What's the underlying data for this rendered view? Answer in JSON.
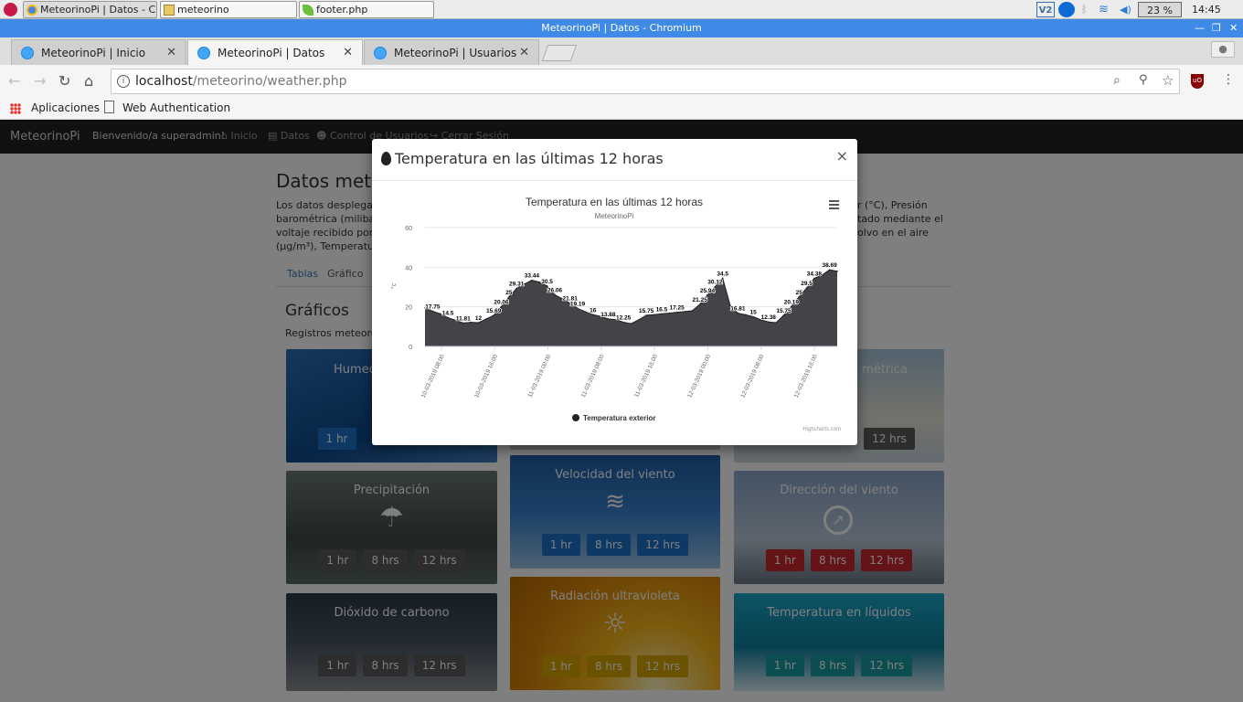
{
  "taskbar": {
    "items": [
      {
        "label": "MeteorinoPi | Datos - Ch..."
      },
      {
        "label": "meteorino"
      },
      {
        "label": "footer.php"
      }
    ],
    "vnc": "V2",
    "volume": "23 %",
    "clock": "14:45"
  },
  "window": {
    "title": "MeteorinoPi | Datos - Chromium"
  },
  "tabs": [
    {
      "label": "MeteorinoPi | Inicio"
    },
    {
      "label": "MeteorinoPi | Datos"
    },
    {
      "label": "MeteorinoPi | Usuarios"
    }
  ],
  "omnibox": {
    "host": "localhost",
    "path": "/meteorino/weather.php"
  },
  "bookmarks": [
    {
      "label": "Aplicaciones"
    },
    {
      "label": "Web Authentication"
    }
  ],
  "navbar": {
    "brand": "MeteorinoPi",
    "welcome": "Bienvenido/a superadmin!",
    "links": [
      "Inicio",
      "Datos",
      "Control de Usuarios",
      "Cerrar Sesión"
    ]
  },
  "content": {
    "heading": "Datos mete",
    "para_lines": [
      "Los datos desplegad",
      "barométrica (milibar),",
      "voltaje recibido por el",
      "(µg/m³), Temperatura"
    ],
    "para_right": [
      "r (°C), Presión",
      "tado mediante el",
      "olvo en el aire"
    ],
    "tabs": [
      "Tablas",
      "Gráfico"
    ],
    "section_title": "Gráficos",
    "section_sub": "Registros meteorol"
  },
  "cards": [
    {
      "title": "Humed",
      "buttons": [
        "1 hr"
      ]
    },
    {
      "title": "métrica",
      "buttons": [
        "12 hrs"
      ]
    },
    {
      "title": "Precipitación",
      "buttons": [
        "1 hr",
        "8 hrs",
        "12 hrs"
      ]
    },
    {
      "title": "Velocidad del viento",
      "buttons": [
        "1 hr",
        "8 hrs",
        "12 hrs"
      ]
    },
    {
      "title": "Dirección del viento",
      "buttons": [
        "1 hr",
        "8 hrs",
        "12 hrs"
      ]
    },
    {
      "title": "Dióxido de carbono",
      "buttons": [
        "1 hr",
        "8 hrs",
        "12 hrs"
      ]
    },
    {
      "title": "Radiación ultravioleta",
      "buttons": [
        "1 hr",
        "8 hrs",
        "12 hrs"
      ]
    },
    {
      "title": "Temperatura en líquidos",
      "buttons": [
        "1 hr",
        "8 hrs",
        "12 hrs"
      ]
    }
  ],
  "modal": {
    "title": "Temperatura en las últimas 12 horas",
    "close": "×"
  },
  "chart_data": {
    "type": "area",
    "title": "Temperatura en las últimas 12 horas",
    "subtitle": "MeteorinoPi",
    "ylabel": "°c",
    "ylim": [
      0,
      60
    ],
    "yticks": [
      0,
      20,
      40,
      60
    ],
    "grid": true,
    "legend": "bottom-center",
    "credits": "Highcharts.com",
    "color": "#434348",
    "xticks": [
      "10-03-2019 08:00",
      "10-03-2019 16:00",
      "11-03-2019 00:00",
      "11-03-2019 08:00",
      "11-03-2019 16:00",
      "12-03-2019 00:00",
      "12-03-2019 08:00",
      "12-03-2019 16:00"
    ],
    "series": [
      {
        "name": "Temperatura exterior",
        "values": [
          19.5,
          17.75,
          16.5,
          14.5,
          13.2,
          11.81,
          12.2,
          12.0,
          13.8,
          15.69,
          20.06,
          25,
          29.31,
          31.5,
          33.44,
          32.5,
          30.5,
          26.06,
          24.0,
          21.81,
          19.19,
          17.5,
          16.0,
          15.2,
          13.88,
          13.5,
          12.25,
          11.5,
          13.5,
          15.75,
          16.0,
          16.5,
          16.8,
          17.25,
          17.6,
          18.0,
          21.25,
          25.94,
          30.12,
          34.5,
          20.5,
          16.81,
          16.0,
          15.0,
          13.5,
          12.38,
          12.0,
          15.75,
          20.19,
          25,
          29.5,
          34.38,
          36.0,
          38.69,
          38.0
        ]
      }
    ],
    "data_labels": [
      {
        "i": 1,
        "text": "17.75"
      },
      {
        "i": 3,
        "text": "14.5"
      },
      {
        "i": 5,
        "text": "11.81"
      },
      {
        "i": 7,
        "text": "12"
      },
      {
        "i": 9,
        "text": "15.69"
      },
      {
        "i": 10,
        "text": "20.06"
      },
      {
        "i": 11,
        "text": "25"
      },
      {
        "i": 12,
        "text": "29.31"
      },
      {
        "i": 14,
        "text": "33.44"
      },
      {
        "i": 16,
        "text": "30.5"
      },
      {
        "i": 17,
        "text": "26.06"
      },
      {
        "i": 19,
        "text": "21.81"
      },
      {
        "i": 20,
        "text": "19.19"
      },
      {
        "i": 22,
        "text": "16"
      },
      {
        "i": 24,
        "text": "13.88"
      },
      {
        "i": 26,
        "text": "12.25"
      },
      {
        "i": 29,
        "text": "15.75"
      },
      {
        "i": 31,
        "text": "16.5"
      },
      {
        "i": 33,
        "text": "17.25"
      },
      {
        "i": 36,
        "text": "21.25"
      },
      {
        "i": 37,
        "text": "25.94"
      },
      {
        "i": 38,
        "text": "30.12"
      },
      {
        "i": 39,
        "text": "34.5"
      },
      {
        "i": 41,
        "text": "16.81"
      },
      {
        "i": 43,
        "text": "15"
      },
      {
        "i": 45,
        "text": "12.38"
      },
      {
        "i": 47,
        "text": "15.75"
      },
      {
        "i": 48,
        "text": "20.19"
      },
      {
        "i": 49,
        "text": "25"
      },
      {
        "i": 50,
        "text": "29.5"
      },
      {
        "i": 51,
        "text": "34.38"
      },
      {
        "i": 53,
        "text": "38.69"
      }
    ]
  },
  "colors": {
    "titlebar": "#3e8ae6",
    "navbar": "#222222",
    "btn_blue": "#1a73c8",
    "btn_gray": "#5a5a5a",
    "btn_red": "#c8282d",
    "btn_yellow": "#d4a400",
    "btn_teal": "#179aa0"
  }
}
